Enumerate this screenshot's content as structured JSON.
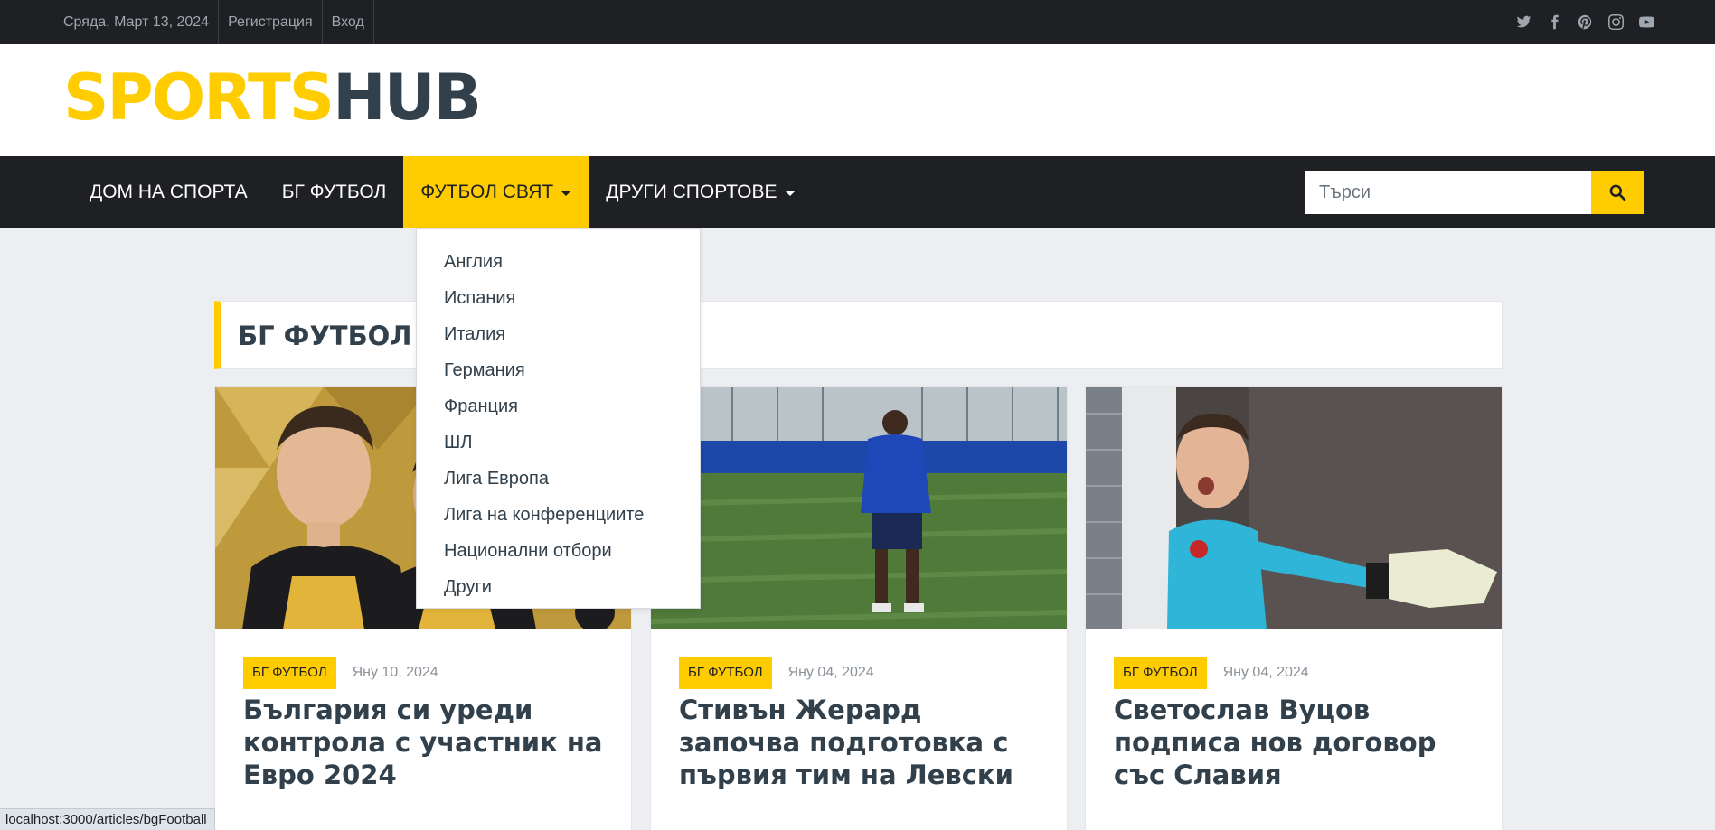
{
  "topbar": {
    "date": "Сряда, Март 13, 2024",
    "register": "Регистрация",
    "login": "Вход",
    "social_icons": [
      "twitter-icon",
      "facebook-icon",
      "pinterest-icon",
      "instagram-icon",
      "youtube-icon"
    ]
  },
  "header": {
    "logo_part1": "SPORTS",
    "logo_part2": "HUB"
  },
  "nav": {
    "items": [
      {
        "label": "ДОМ НА СПОРТА"
      },
      {
        "label": "БГ ФУТБОЛ"
      },
      {
        "label": "ФУТБОЛ СВЯТ"
      },
      {
        "label": "ДРУГИ СПОРТОВЕ"
      }
    ],
    "search_placeholder": "Търси"
  },
  "dropdown": {
    "items": [
      "Англия",
      "Испания",
      "Италия",
      "Германия",
      "Франция",
      "ШЛ",
      "Лига Европа",
      "Лига на конференциите",
      "Национални отбори",
      "Други"
    ]
  },
  "section": {
    "title": "БГ ФУТБОЛ"
  },
  "articles": [
    {
      "category": "БГ ФУТБОЛ",
      "date": "Яну 10, 2024",
      "title": "България си уреди контрола с участник на Евро 2024"
    },
    {
      "category": "БГ ФУТБОЛ",
      "date": "Яну 04, 2024",
      "title": "Стивън Жерард започва подготовка с първия тим на Левски"
    },
    {
      "category": "БГ ФУТБОЛ",
      "date": "Яну 04, 2024",
      "title": "Светослав Вуцов подписа нов договор със Славия"
    }
  ],
  "statusbar": {
    "url": "localhost:3000/articles/bgFootball"
  },
  "colors": {
    "accent": "#ffcc00",
    "dark": "#1e2024",
    "text": "#31404b",
    "background": "#edeef2"
  }
}
